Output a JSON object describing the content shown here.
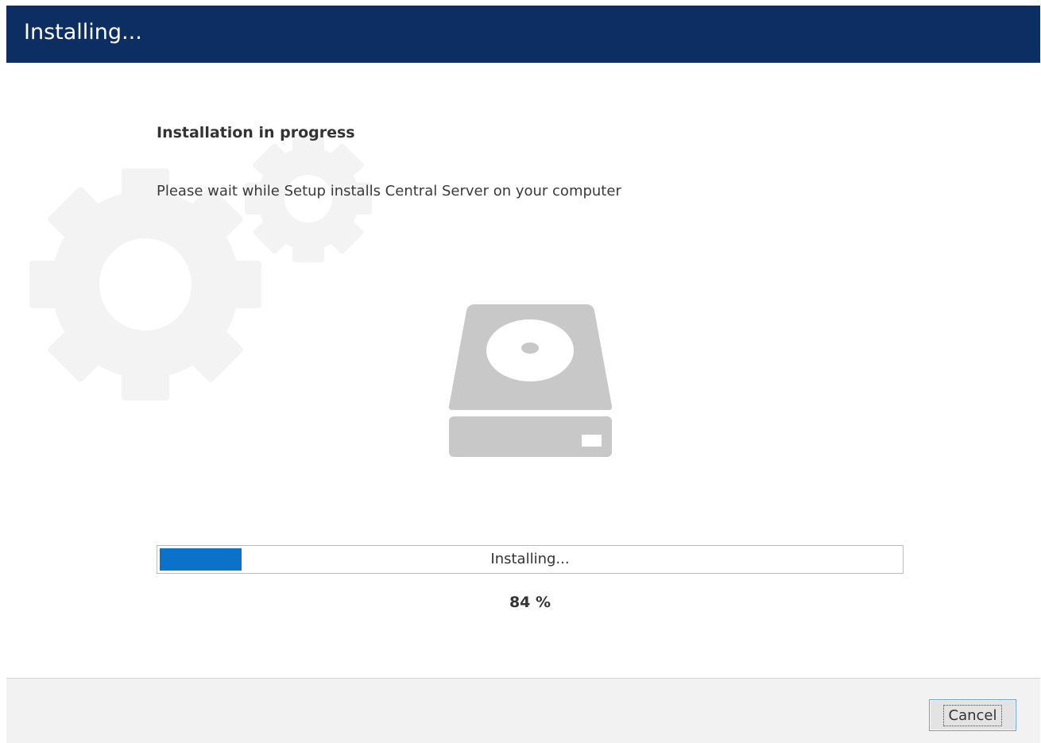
{
  "window": {
    "title": "Installing..."
  },
  "main": {
    "heading": "Installation in progress",
    "description": "Please wait while Setup installs Central Server on your computer"
  },
  "progress": {
    "status_text": "Installing...",
    "percent_text": "84 %",
    "bar_fill_fraction": 0.11
  },
  "footer": {
    "cancel_label": "Cancel"
  },
  "colors": {
    "titlebar_bg": "#0d2e63",
    "progress_fill": "#0a72c8",
    "footer_bg": "#f2f2f2",
    "icon_gray": "#c8c8c8",
    "gear_watermark": "#f3f3f3"
  },
  "icons": {
    "background": "gears-icon",
    "central": "hard-drive-icon"
  }
}
